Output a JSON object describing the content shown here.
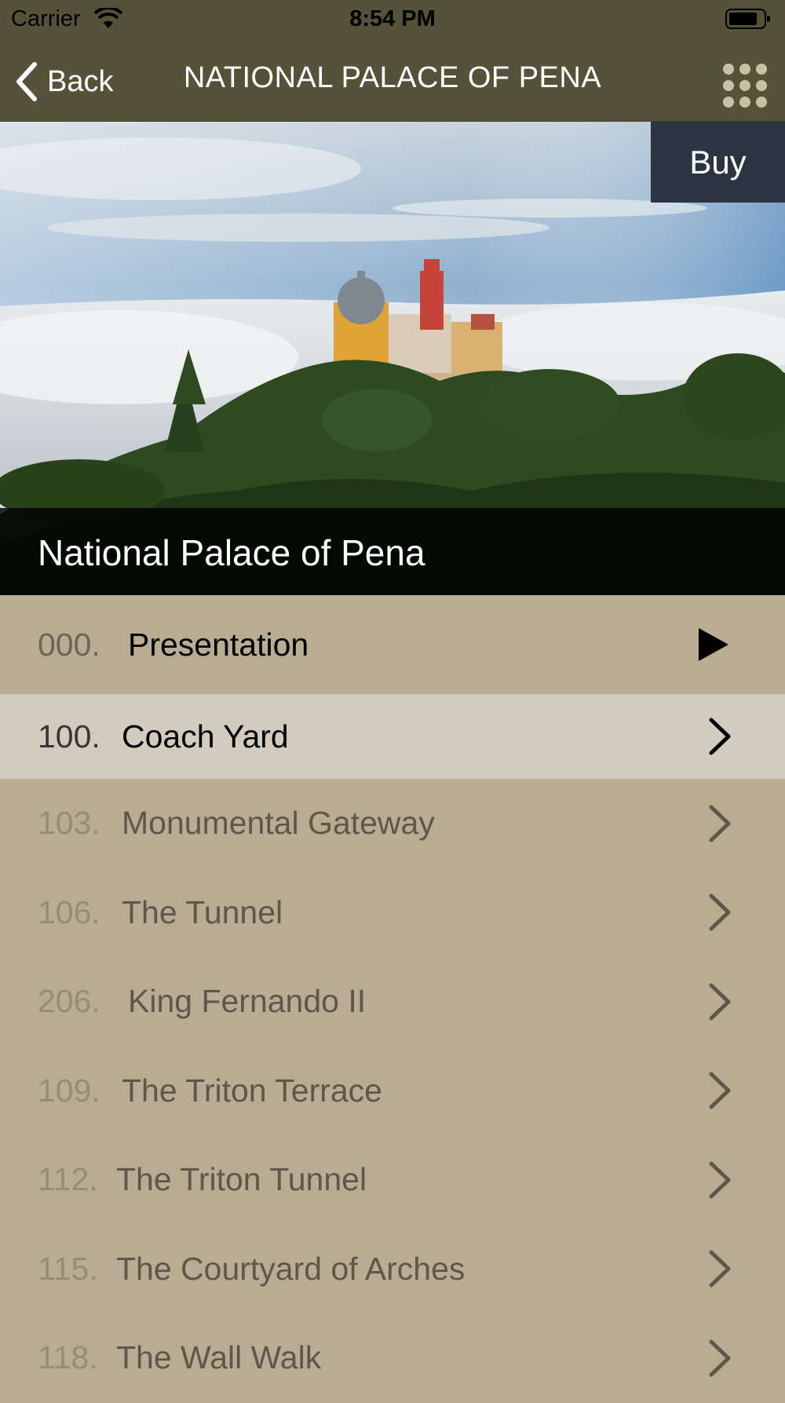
{
  "status_bar": {
    "carrier": "Carrier",
    "time": "8:54 PM"
  },
  "nav": {
    "back_label": "Back",
    "title": "NATIONAL PALACE OF PENA",
    "menu_icon": "grid-icon"
  },
  "hero": {
    "buy_label": "Buy",
    "caption": "National Palace of Pena"
  },
  "list": [
    {
      "num": "000.",
      "title": "Presentation",
      "icon": "play-icon"
    },
    {
      "num": "100.",
      "title": "Coach Yard",
      "icon": "chevron-right-icon"
    },
    {
      "num": "103.",
      "title": "Monumental Gateway",
      "icon": "chevron-right-icon"
    },
    {
      "num": "106.",
      "title": "The Tunnel",
      "icon": "chevron-right-icon"
    },
    {
      "num": "206.",
      "title": "King Fernando II",
      "icon": "chevron-right-icon"
    },
    {
      "num": "109.",
      "title": "The Triton Terrace",
      "icon": "chevron-right-icon"
    },
    {
      "num": "112.",
      "title": "The Triton Tunnel",
      "icon": "chevron-right-icon"
    },
    {
      "num": "115.",
      "title": "The Courtyard of Arches",
      "icon": "chevron-right-icon"
    },
    {
      "num": "118.",
      "title": "The Wall Walk",
      "icon": "chevron-right-icon"
    }
  ],
  "colors": {
    "nav_bg": "#545238",
    "list_bg": "#b8ad93",
    "selected_bg": "#d2cbbf",
    "buy_bg": "#2b3542"
  }
}
